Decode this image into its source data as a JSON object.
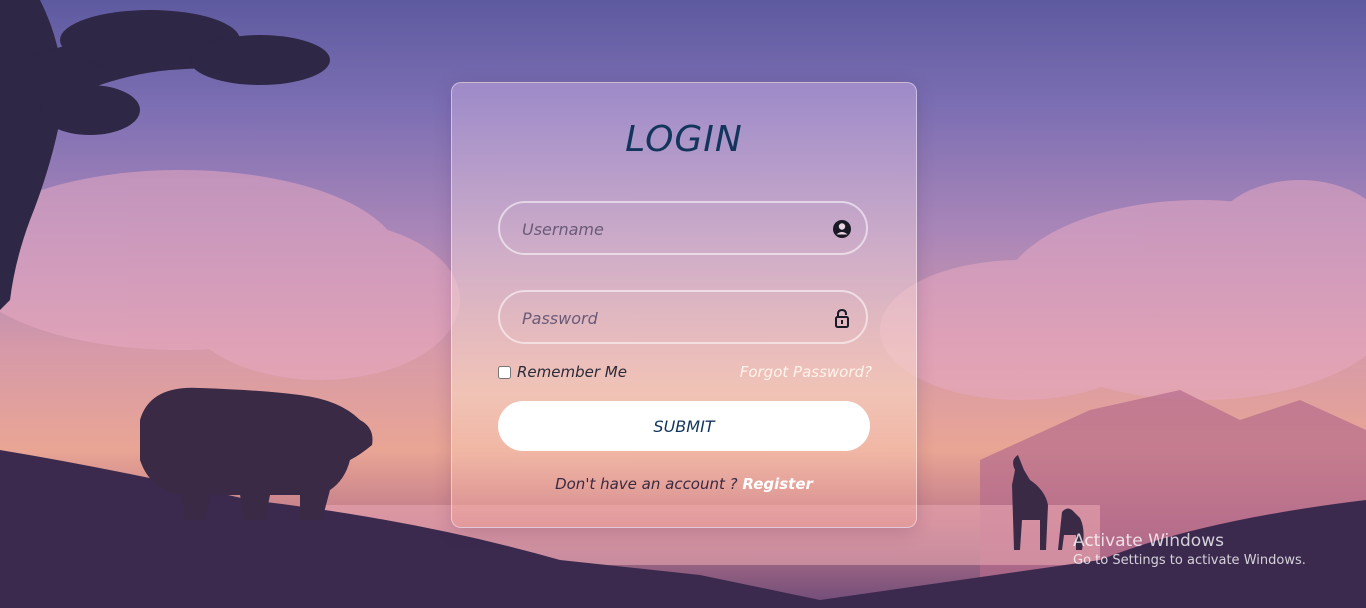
{
  "form": {
    "title": "LOGIN",
    "username_placeholder": "Username",
    "password_placeholder": "Password",
    "remember_label": "Remember Me",
    "forgot_label": "Forgot Password?",
    "submit_label": "SUBMIT",
    "register_prompt": "Don't have an account ? ",
    "register_link": "Register"
  },
  "icons": {
    "username": "user-circle-icon",
    "password": "lock-icon"
  },
  "watermark": {
    "line1": "Activate Windows",
    "line2": "Go to Settings to activate Windows."
  },
  "colors": {
    "title": "#13355c",
    "submit_bg": "#ffffff",
    "link": "#ffffff"
  }
}
